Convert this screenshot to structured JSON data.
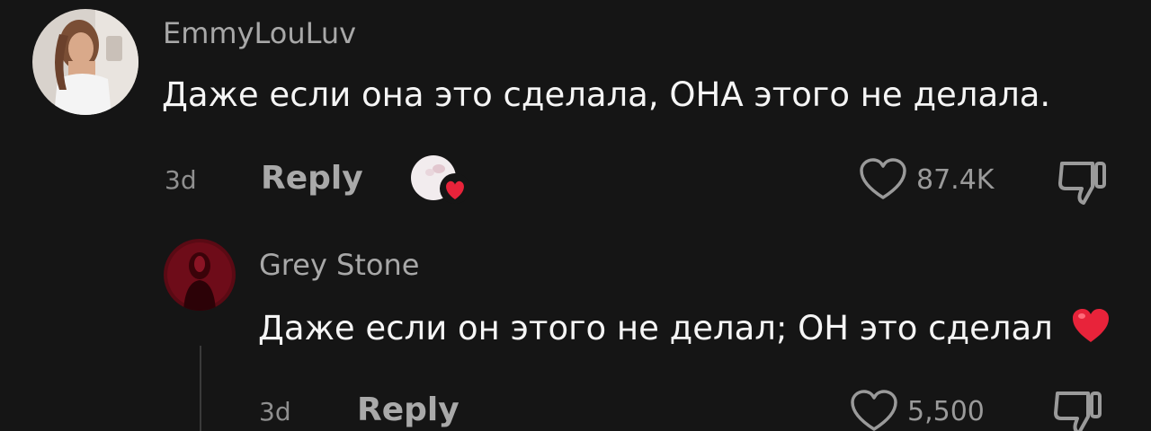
{
  "comments": [
    {
      "username": "EmmyLouLuv",
      "text": "Даже если она это сделала, ОНА этого не делала.",
      "timestamp": "3d",
      "reply_label": "Reply",
      "likes": "87.4K",
      "creator_liked": true
    },
    {
      "username": "Grey Stone",
      "text": "Даже если он этого не делал; ОН это сделал",
      "emoji": "heart-emoji",
      "timestamp": "3d",
      "reply_label": "Reply",
      "likes": "5,500"
    }
  ],
  "colors": {
    "background": "#151515",
    "text": "#f5f5f5",
    "muted": "#a8a8a8",
    "heart": "#e8233a"
  }
}
